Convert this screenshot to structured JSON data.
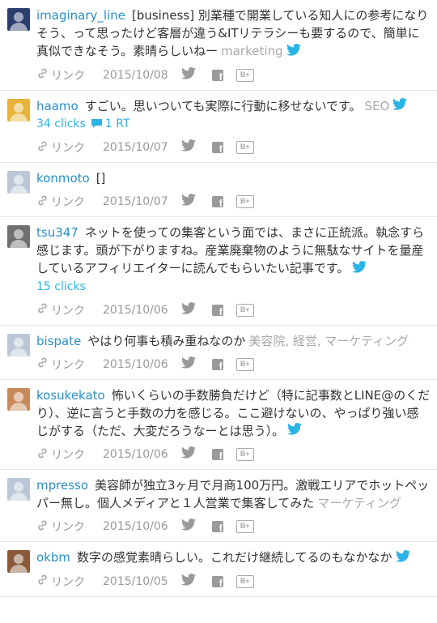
{
  "ui": {
    "link_label": "リンク"
  },
  "entries": [
    {
      "user": "imaginary_line",
      "text": "[business] 別業種で開業している知人にの参考になりそう、って思ったけど客層が違う&ITリテラシーも要するので、簡単に真似できなそう。素晴らしいねー",
      "tags": "marketing",
      "date": "2015/10/08",
      "avatar_color": "#2c3e6e"
    },
    {
      "user": "haamo",
      "text": "すごい。思いついても実際に行動に移せないです。",
      "tags": "SEO",
      "clicks": "34 clicks",
      "rt": "1 RT",
      "date": "2015/10/07",
      "avatar_color": "#e8b33a"
    },
    {
      "user": "konmoto",
      "text": "[]",
      "tags": "",
      "date": "2015/10/07",
      "avatar_color": "#b9c7d6"
    },
    {
      "user": "tsu347",
      "text": "ネットを使っての集客という面では、まさに正統派。執念すら感じます。頭が下がりますね。産業廃棄物のように無駄なサイトを量産しているアフィリエイターに読んでもらいたい記事です。",
      "tags": "",
      "clicks": "15 clicks",
      "date": "2015/10/06",
      "avatar_color": "#707070"
    },
    {
      "user": "bispate",
      "text": "やはり何事も積み重ねなのか",
      "tags": "美容院, 経営, マーケティング",
      "date": "2015/10/06",
      "avatar_color": "#b9c7d6"
    },
    {
      "user": "kosukekato",
      "text": "怖いくらいの手数勝負だけど（特に記事数とLINE@のくだり）、逆に言うと手数の力を感じる。ここ避けないの、やっぱり強い感じがする（ただ、大変だろうなーとは思う）。",
      "tags": "",
      "date": "2015/10/06",
      "avatar_color": "#c98a5a"
    },
    {
      "user": "mpresso",
      "text": "美容師が独立3ヶ月で月商100万円。激戦エリアでホットペッパー無し。個人メディアと１人営業で集客してみた",
      "tags": "マーケティング",
      "date": "2015/10/06",
      "avatar_color": "#b9c7d6"
    },
    {
      "user": "okbm",
      "text": "数字の感覚素晴らしい。これだけ継続してるのもなかなか",
      "tags": "",
      "date": "2015/10/05",
      "avatar_color": "#8a5a3a"
    }
  ]
}
